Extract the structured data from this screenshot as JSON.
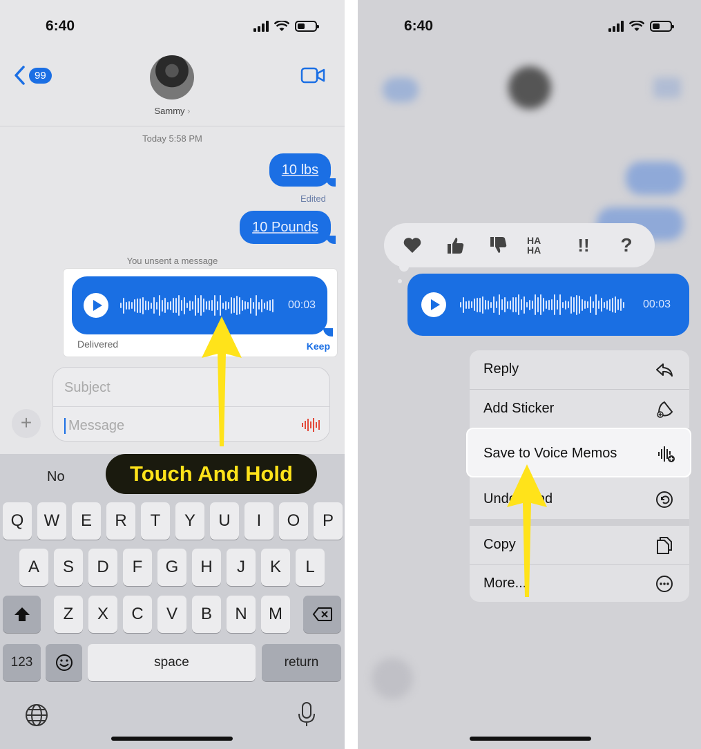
{
  "status": {
    "time": "6:40"
  },
  "left": {
    "back_count": "99",
    "contact_name": "Sammy",
    "contact_chevron": "›",
    "timestamp": "Today 5:58 PM",
    "messages": [
      {
        "text": "10 lbs",
        "meta": "Edited"
      },
      {
        "text": "10 Pounds"
      }
    ],
    "unsent_note": "You unsent a message",
    "voice": {
      "duration": "00:03",
      "status": "Delivered",
      "keep_label": "Keep"
    },
    "compose": {
      "subject_placeholder": "Subject",
      "message_placeholder": "Message",
      "plus": "+"
    },
    "keyboard": {
      "suggestion": "No",
      "row1": [
        "Q",
        "W",
        "E",
        "R",
        "T",
        "Y",
        "U",
        "I",
        "O",
        "P"
      ],
      "row2": [
        "A",
        "S",
        "D",
        "F",
        "G",
        "H",
        "J",
        "K",
        "L"
      ],
      "row3": [
        "Z",
        "X",
        "C",
        "V",
        "B",
        "N",
        "M"
      ],
      "numbers_key": "123",
      "space_key": "space",
      "return_key": "return"
    },
    "callout": "Touch And Hold"
  },
  "right": {
    "reactions": [
      {
        "icon": "heart-icon"
      },
      {
        "icon": "thumbs-up-icon"
      },
      {
        "icon": "thumbs-down-icon"
      },
      {
        "icon": "haha-icon",
        "text": "HA HA"
      },
      {
        "icon": "exclamation-icon",
        "text": "!!"
      },
      {
        "icon": "question-icon",
        "text": "?"
      }
    ],
    "voice": {
      "duration": "00:03"
    },
    "menu": [
      {
        "label": "Reply",
        "icon": "reply-icon"
      },
      {
        "label": "Add Sticker",
        "icon": "sticker-icon"
      },
      {
        "label": "Save to Voice Memos",
        "icon": "voice-memo-icon",
        "highlighted": true
      },
      {
        "label": "Undo Send",
        "icon": "undo-icon"
      },
      {
        "label": "Copy",
        "icon": "copy-icon"
      },
      {
        "label": "More...",
        "icon": "more-icon"
      }
    ]
  },
  "colors": {
    "imessage_blue": "#1b6fe4",
    "callout_yellow": "#ffe31a",
    "record_red": "#e34a3b"
  }
}
